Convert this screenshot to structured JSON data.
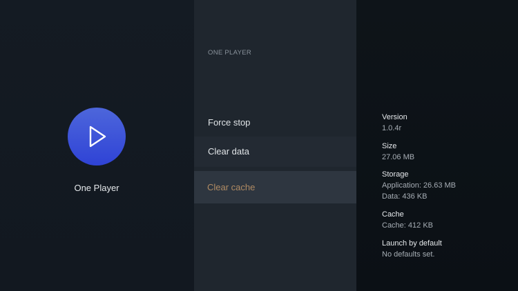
{
  "app": {
    "name": "One Player",
    "icon": "play-icon"
  },
  "menu": {
    "header": "ONE PLAYER",
    "items": [
      {
        "label": "Force stop"
      },
      {
        "label": "Clear data"
      },
      {
        "label": "Clear cache",
        "state": "focused"
      }
    ]
  },
  "info": {
    "version": {
      "label": "Version",
      "value": "1.0.4r"
    },
    "size": {
      "label": "Size",
      "value": "27.06 MB"
    },
    "storage": {
      "label": "Storage",
      "application": "Application: 26.63 MB",
      "data": "Data: 436 KB"
    },
    "cache": {
      "label": "Cache",
      "value": "Cache: 412 KB"
    },
    "launch": {
      "label": "Launch by default",
      "value": "No defaults set."
    }
  },
  "colors": {
    "icon_blue": "#3a4fd8",
    "focus_text": "#b08b63"
  }
}
